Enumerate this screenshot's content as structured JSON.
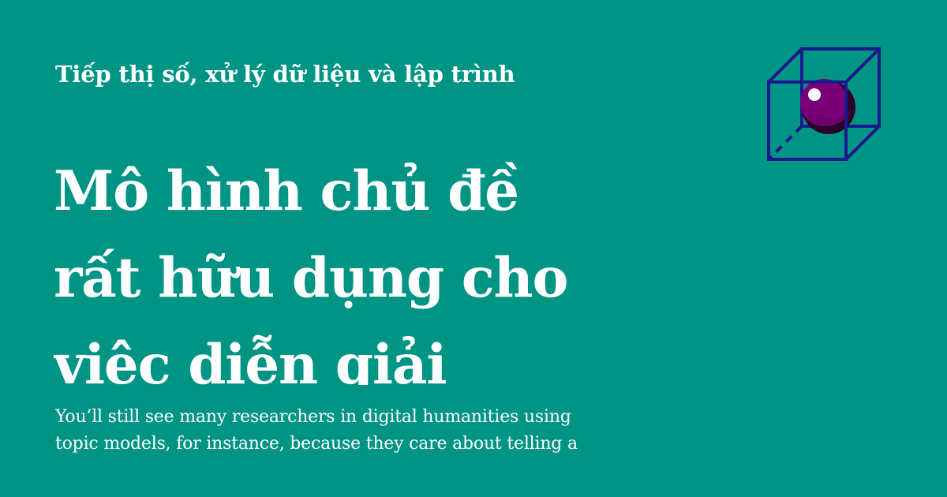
{
  "card": {
    "category": "Tiếp thị số, xử lý dữ liệu và lập trình",
    "title_lines": [
      "Mô hình chủ đề",
      "rất hữu dụng cho",
      "viêc diễn giải"
    ],
    "excerpt_lines": [
      "You’ll still see many researchers in digital humanities using",
      "topic models, for instance, because they care about telling a"
    ]
  },
  "colors": {
    "background": "#009485",
    "text": "#ffffff",
    "logo_cube": "#1a1a8c",
    "logo_sphere": "#7a007a",
    "logo_sphere_shadow": "#2a002a"
  },
  "icons": {
    "logo": "cube-with-sphere-icon"
  }
}
